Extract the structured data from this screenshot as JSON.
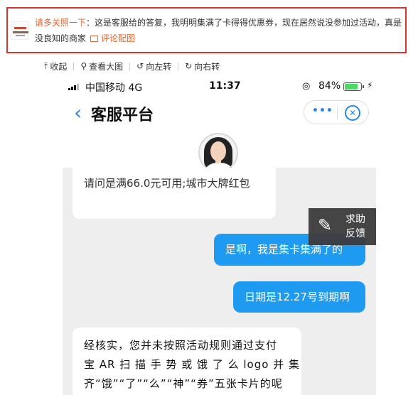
{
  "comment": {
    "avatar_icon": "merchant-logo",
    "username": "请多关照一下",
    "separator": "：",
    "text": "这是客服给的答复，我明明集满了卡得得优惠券，现在居然说没参加过活动，真是没良知的商家",
    "pic_link": "评论配图"
  },
  "toolbar": {
    "items": [
      {
        "icon": "collapse-icon",
        "glyph": "⤒",
        "label": "收起"
      },
      {
        "icon": "zoom-icon",
        "glyph": "🔍︎",
        "label": "查看大图"
      },
      {
        "icon": "rotate-left-icon",
        "glyph": "↺",
        "label": "向左转"
      },
      {
        "icon": "rotate-right-icon",
        "glyph": "↻",
        "label": "向右转"
      }
    ]
  },
  "phone": {
    "status": {
      "carrier": "中国移动  4G",
      "time": "11:37",
      "battery": "84%",
      "battery_level": 0.84,
      "battery_color": "#4cd964"
    },
    "nav": {
      "back_glyph": "‹",
      "title": "客服平台",
      "more_glyph": "•••",
      "close_glyph": "✕"
    },
    "messages": [
      {
        "from": "agent",
        "text": "请问是满66.0元可用;城市大牌红包"
      },
      {
        "from": "user",
        "text": "是啊，我是集卡集满了的"
      },
      {
        "from": "user",
        "text": "日期是12.27号到期啊"
      },
      {
        "from": "agent",
        "lines": [
          "经核实，您并未按照活动规则通过支付",
          "宝 AR 扫 描 手 势 或 饿 了 么 logo 并 集",
          "齐“饿”“了”“么”“神”“券”五张卡片的呢"
        ]
      }
    ],
    "help": {
      "glyph": "✎",
      "line1": "求助",
      "line2": "反馈"
    }
  },
  "colors": {
    "accent": "#2b86e3",
    "bubble_user": "#1e9bf0",
    "comment_border": "#d9332f",
    "username": "#e5652d"
  }
}
